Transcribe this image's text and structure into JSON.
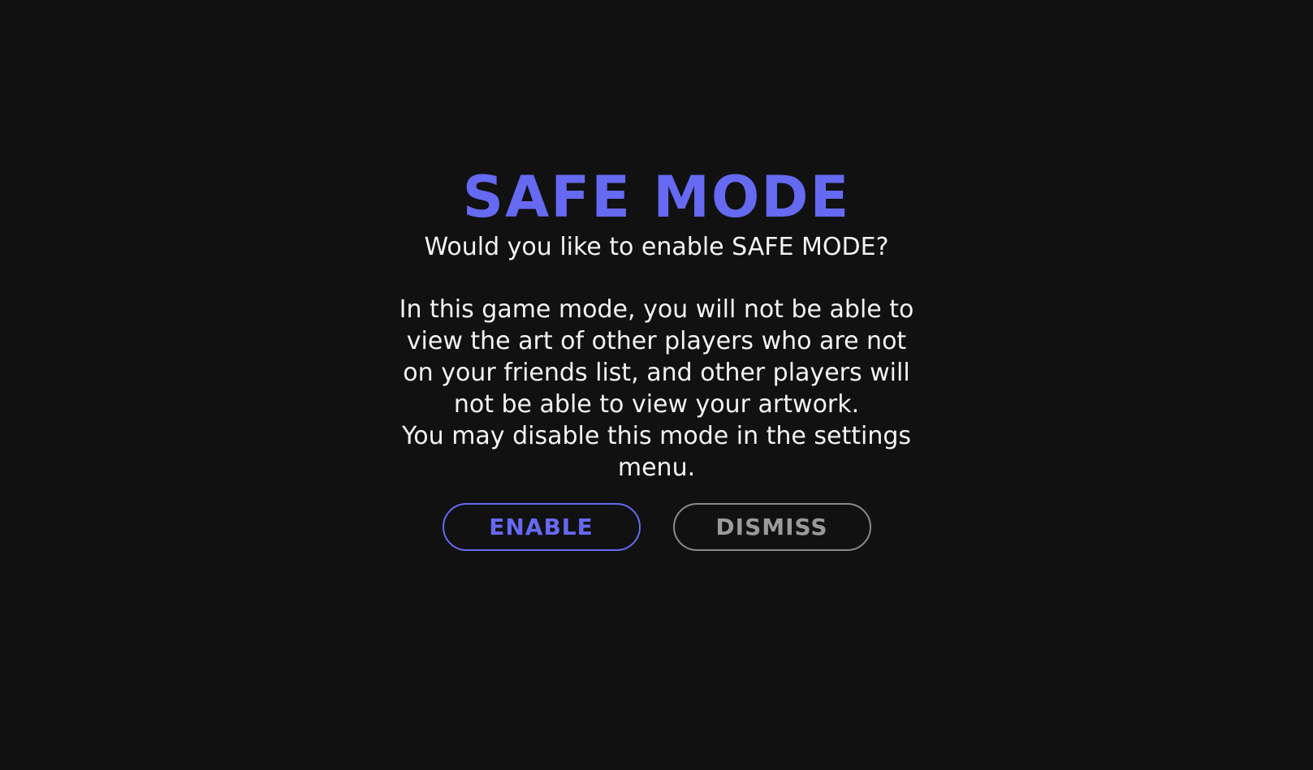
{
  "safe_mode_dialog": {
    "title": "SAFE MODE",
    "question": "Would you like to enable SAFE MODE?",
    "description": "In this game mode, you will not be able to view the art of other players who are not on your friends list, and other players will not be able to view your artwork.",
    "note": "You may disable this mode in the settings menu.",
    "enable_label": "ENABLE",
    "dismiss_label": "DISMISS"
  },
  "colors": {
    "background": "#111112",
    "accent": "#6669f1",
    "text": "#f3f3f3",
    "muted": "#9a9a9a"
  }
}
